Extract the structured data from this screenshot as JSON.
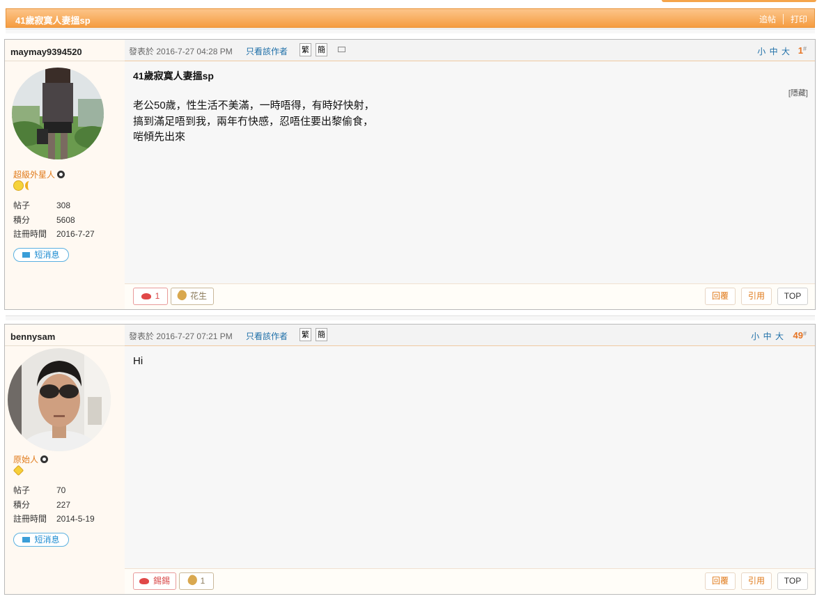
{
  "thread": {
    "title": "41歲寂寞人妻搵sp",
    "actions": {
      "follow": "追帖",
      "print": "打印"
    }
  },
  "colors": {
    "accent": "#f59c40",
    "link": "#1e6fa8",
    "floor": "#e67322"
  },
  "labels": {
    "posted_prefix": "發表於",
    "only_author": "只看該作者",
    "trad": "繁",
    "simp": "簡",
    "size_small": "小",
    "size_mid": "中",
    "size_big": "大",
    "hash": "#",
    "posts": "帖子",
    "points": "積分",
    "reg_time": "註冊時間",
    "pm": "短消息",
    "reply": "回覆",
    "quote": "引用",
    "top": "TOP",
    "hidden": "[隱藏]"
  },
  "posts": [
    {
      "author": "maymay9394520",
      "rank": "超級外星人",
      "medals": [
        "smile-medal",
        "moon-medal"
      ],
      "post_count": "308",
      "points": "5608",
      "registered": "2016-7-27",
      "datetime": "2016-7-27 04:28 PM",
      "floor": "1",
      "title": "41歲寂寞人妻搵sp",
      "body_lines": [
        "老公50歲，性生活不美滿，一時唔得，有時好快射，",
        "搞到滿足唔到我，兩年冇快感，忍唔住要出黎偷食，",
        "啱傾先出來"
      ],
      "kiss_label": "1",
      "nut_label": "花生"
    },
    {
      "author": "bennysam",
      "rank": "原始人",
      "medals": [
        "star-medal"
      ],
      "post_count": "70",
      "points": "227",
      "registered": "2014-5-19",
      "datetime": "2016-7-27 07:21 PM",
      "floor": "49",
      "body": "Hi",
      "kiss_label": "錫錫",
      "nut_label": "1"
    }
  ]
}
